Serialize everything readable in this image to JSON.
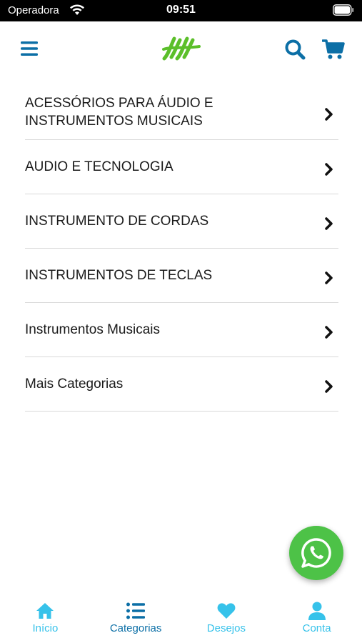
{
  "status_bar": {
    "carrier": "Operadora",
    "time": "09:51"
  },
  "header": {
    "menu_icon": "hamburger-menu-icon",
    "logo_icon": "hh-logo",
    "search_icon": "search-icon",
    "cart_icon": "cart-icon"
  },
  "categories": [
    {
      "label": "ACESSÓRIOS PARA ÁUDIO E INSTRUMENTOS MUSICAIS"
    },
    {
      "label": "AUDIO E TECNOLOGIA"
    },
    {
      "label": "INSTRUMENTO DE CORDAS"
    },
    {
      "label": "INSTRUMENTOS DE TECLAS"
    },
    {
      "label": "Instrumentos Musicais"
    },
    {
      "label": "Mais Categorias"
    }
  ],
  "tabs": [
    {
      "label": "Início",
      "icon": "home-icon"
    },
    {
      "label": "Categorias",
      "icon": "list-icon",
      "active": true
    },
    {
      "label": "Desejos",
      "icon": "heart-icon"
    },
    {
      "label": "Conta",
      "icon": "user-icon"
    }
  ],
  "colors": {
    "primary": "#0c6fa6",
    "accent": "#36c2ea",
    "logo_green": "#5bbf2a",
    "whatsapp": "#4dc247"
  }
}
